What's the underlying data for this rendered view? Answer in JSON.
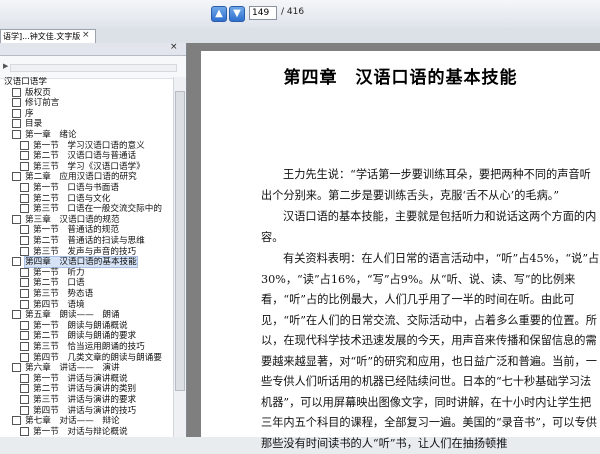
{
  "toolbar": {
    "prev_icon": "up-arrow-icon",
    "next_icon": "down-arrow-icon",
    "page_current": "149",
    "page_total": "/ 416"
  },
  "tab": {
    "label": "语学]...钟文佳.文字版",
    "close": "×"
  },
  "panel": {
    "close": "×",
    "scroll_arrow": "▶",
    "tree": [
      {
        "label": "汉语口语学",
        "cb": false,
        "sel": false
      },
      {
        "label": "版权页",
        "cb": true,
        "sel": false
      },
      {
        "label": "修订前言",
        "cb": true,
        "sel": false
      },
      {
        "label": "序",
        "cb": true,
        "sel": false
      },
      {
        "label": "目录",
        "cb": true,
        "sel": false
      },
      {
        "label": "第一章　绪论",
        "cb": true,
        "sel": false
      },
      {
        "label": "第一节　学习汉语口语的意义",
        "cb": true,
        "sel": false
      },
      {
        "label": "第二节　汉语口语与普通话",
        "cb": true,
        "sel": false
      },
      {
        "label": "第三节　学习《汉语口语学》",
        "cb": true,
        "sel": false
      },
      {
        "label": "第二章　应用汉语口语的研究",
        "cb": true,
        "sel": false
      },
      {
        "label": "第一节　口语与书面语",
        "cb": true,
        "sel": false
      },
      {
        "label": "第二节　口语与文化",
        "cb": true,
        "sel": false
      },
      {
        "label": "第三节　口语在一般交流交际中的",
        "cb": true,
        "sel": false
      },
      {
        "label": "第三章　汉语口语的规范",
        "cb": true,
        "sel": false
      },
      {
        "label": "第一节　普通话的规范",
        "cb": true,
        "sel": false
      },
      {
        "label": "第二节　普通话的扫读与思维",
        "cb": true,
        "sel": false
      },
      {
        "label": "第三节　发声与声音的技巧",
        "cb": true,
        "sel": false
      },
      {
        "label": "第四章　汉语口语的基本技能",
        "cb": true,
        "sel": true
      },
      {
        "label": "第一节　听力",
        "cb": true,
        "sel": false
      },
      {
        "label": "第二节　口语",
        "cb": true,
        "sel": false
      },
      {
        "label": "第三节　势态语",
        "cb": true,
        "sel": false
      },
      {
        "label": "第四节　语境",
        "cb": true,
        "sel": false
      },
      {
        "label": "第五章　朗读——　朗诵",
        "cb": true,
        "sel": false
      },
      {
        "label": "第一节　朗读与朗诵概说",
        "cb": true,
        "sel": false
      },
      {
        "label": "第二节　朗读与朗诵的要求",
        "cb": true,
        "sel": false
      },
      {
        "label": "第三节　恰当运用朗诵的技巧",
        "cb": true,
        "sel": false
      },
      {
        "label": "第四节　几类文章的朗读与朗诵要",
        "cb": true,
        "sel": false
      },
      {
        "label": "第六章　讲话——　演讲",
        "cb": true,
        "sel": false
      },
      {
        "label": "第一节　讲话与演讲概说",
        "cb": true,
        "sel": false
      },
      {
        "label": "第二节　讲话与演讲的类别",
        "cb": true,
        "sel": false
      },
      {
        "label": "第三节　讲话与演讲的要求",
        "cb": true,
        "sel": false
      },
      {
        "label": "第四节　讲话与演讲的技巧",
        "cb": true,
        "sel": false
      },
      {
        "label": "第七章　对话——　辩论",
        "cb": true,
        "sel": false
      },
      {
        "label": "第一节　对话与辩论概说",
        "cb": true,
        "sel": false
      }
    ]
  },
  "document": {
    "chapter_title": "第四章　汉语口语的基本技能",
    "para1": "王力先生说：“学话第一步要训练耳朵，要把两种不同的声音听出个分别来。第二步是要训练舌头，克服‘舌不从心’的毛病。”",
    "para2": "汉语口语的基本技能，主要就是包括听力和说话这两个方面的内容。",
    "para3": "有关资料表明：在人们日常的语言活动中，“听”占45%，“说”占30%，“读”占16%，“写”占9%。从“听、说、读、写”的比例来看，“听”占的比例最大，人们几乎用了一半的时间在听。由此可见，“听”在人们的日常交流、交际活动中，占着多么重要的位置。所以，在现代科学技术迅速发展的今天，用声音来传播和保留信息的需要越来越显著，对“听”的研究和应用，也日益广泛和普遍。当前，一些专供人们听话用的机器已经陆续问世。日本的“七十秒基础学习法机器”，可以用屏幕映出图像文字，同时讲解，在十小时内让学生把三年内五个科目的课程，全部复习一遍。美国的“录音书”，可以专供那些没有时间读书的人“听”书，让人们在抽扬顿推"
  }
}
